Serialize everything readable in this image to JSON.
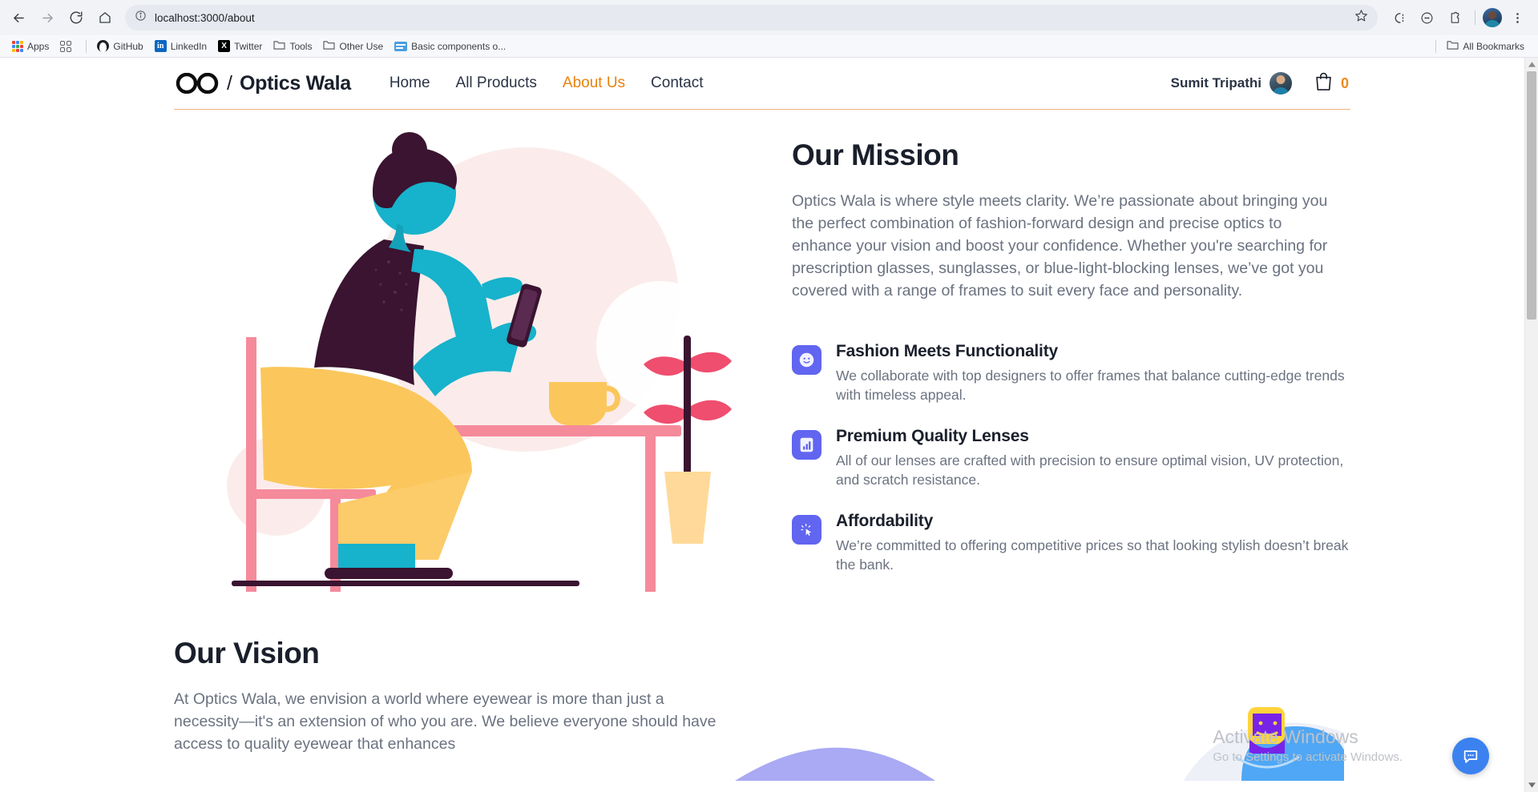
{
  "browser": {
    "url": "localhost:3000/about",
    "nav": {
      "back_label": "Back",
      "forward_label": "Forward",
      "reload_label": "Reload",
      "home_label": "Home"
    },
    "omnibox": {
      "site_info_label": "View site information",
      "bookmark_label": "Bookmark this tab"
    },
    "toolbar_icons": [
      {
        "name": "extensions-split-icon",
        "label": "Split view"
      },
      {
        "name": "clock-history-icon",
        "label": "History"
      },
      {
        "name": "extensions-puzzle-icon",
        "label": "Extensions"
      }
    ],
    "profile_label": "Profile",
    "menu_label": "Customize and control Chrome",
    "bookmarks": [
      {
        "label": "Apps",
        "icon": "apps-grid-icon"
      },
      {
        "label": "",
        "icon": "reading-list-icon"
      },
      {
        "label": "GitHub",
        "icon": "github-icon"
      },
      {
        "label": "LinkedIn",
        "icon": "linkedin-icon"
      },
      {
        "label": "Twitter",
        "icon": "twitter-x-icon"
      },
      {
        "label": "Tools",
        "icon": "folder-icon"
      },
      {
        "label": "Other Use",
        "icon": "folder-icon"
      },
      {
        "label": "Basic components o...",
        "icon": "blue-doc-icon"
      }
    ],
    "all_bookmarks_label": "All Bookmarks"
  },
  "site": {
    "brand": {
      "logo_icon": "glasses-icon",
      "separator": "/",
      "name": "Optics Wala"
    },
    "nav": [
      {
        "label": "Home",
        "active": false
      },
      {
        "label": "All Products",
        "active": false
      },
      {
        "label": "About Us",
        "active": true
      },
      {
        "label": "Contact",
        "active": false
      }
    ],
    "user": {
      "name": "Sumit Tripathi",
      "avatar_label": "User avatar"
    },
    "cart": {
      "icon": "shopping-bag-icon",
      "count": "0"
    },
    "colors": {
      "accent_orange": "#e8820c",
      "cart_orange": "#f08a1d",
      "heading_dark": "#1a1f2b",
      "body_gray": "#6b7280",
      "icon_indigo": "#6165f0",
      "header_border": "#f0b27a",
      "fab_blue": "#3b82f0"
    }
  },
  "mission": {
    "heading": "Our Mission",
    "paragraph": "Optics Wala is where style meets clarity. We’re passionate about bringing you the perfect combination of fashion-forward design and precise optics to enhance your vision and boost your confidence. Whether you're searching for prescription glasses, sunglasses, or blue-light-blocking lenses, we’ve got you covered with a range of frames to suit every face and personality.",
    "illustration_label": "person-reading-at-desk-illustration",
    "features": [
      {
        "icon": "smiley-face-icon",
        "title": "Fashion Meets Functionality",
        "description": "We collaborate with top designers to offer frames that balance cutting-edge trends with timeless appeal."
      },
      {
        "icon": "bar-chart-icon",
        "title": "Premium Quality Lenses",
        "description": "All of our lenses are crafted with precision to ensure optimal vision, UV protection, and scratch resistance."
      },
      {
        "icon": "cursor-click-sparkle-icon",
        "title": "Affordability",
        "description": "We’re committed to offering competitive prices so that looking stylish doesn’t break the bank."
      }
    ]
  },
  "vision": {
    "heading": "Our Vision",
    "paragraph": "At Optics Wala, we envision a world where eyewear is more than just a necessity—it's an extension of who you are. We believe everyone should have access to quality eyewear that enhances",
    "illustration_label": "bearded-person-illustration"
  },
  "watermark": {
    "title": "Activate Windows",
    "subtitle": "Go to Settings to activate Windows."
  },
  "chat": {
    "icon": "chat-bubble-icon",
    "label": "Open chat"
  }
}
